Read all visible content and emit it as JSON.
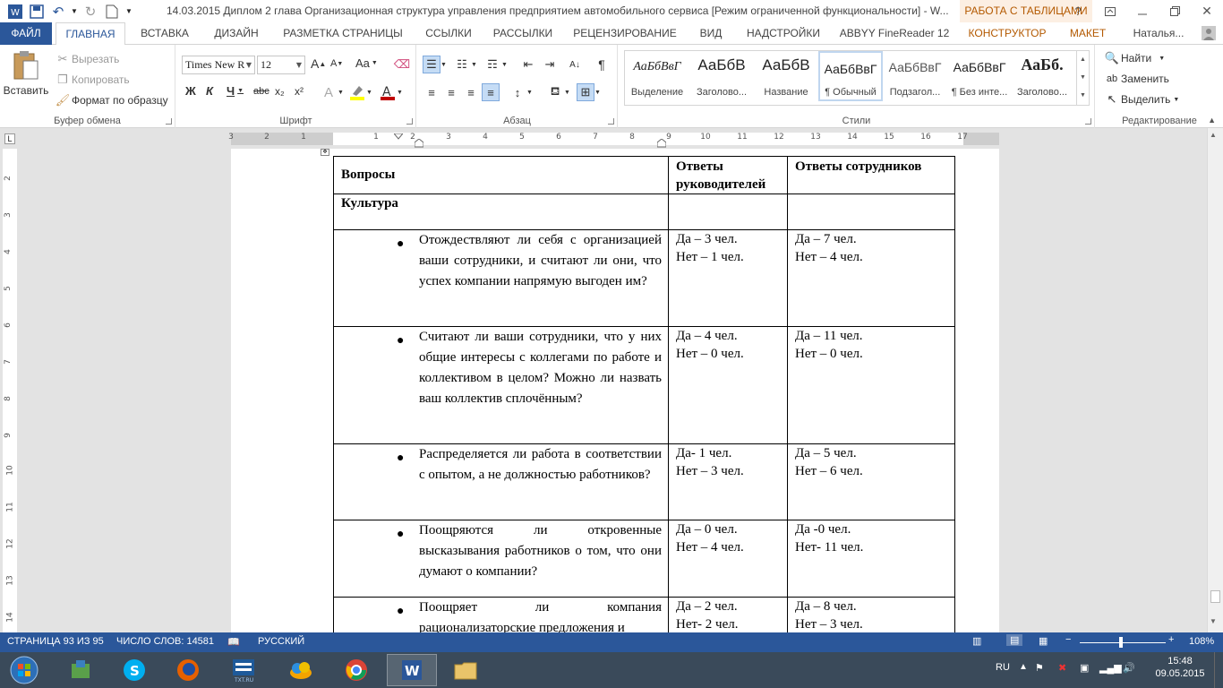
{
  "window": {
    "title": "14.03.2015 Диплом 2 глава Организационная структура управления предприятием автомобильного сервиса [Режим ограниченной функциональности] - W...",
    "context_group": "РАБОТА С ТАБЛИЦАМИ"
  },
  "tabs": {
    "file": "ФАЙЛ",
    "items": [
      "ГЛАВНАЯ",
      "ВСТАВКА",
      "ДИЗАЙН",
      "РАЗМЕТКА СТРАНИЦЫ",
      "ССЫЛКИ",
      "РАССЫЛКИ",
      "РЕЦЕНЗИРОВАНИЕ",
      "ВИД",
      "НАДСТРОЙКИ",
      "ABBYY FineReader 12",
      "КОНСТРУКТОР",
      "МАКЕТ"
    ],
    "user": "Наталья..."
  },
  "clipboard": {
    "paste": "Вставить",
    "cut": "Вырезать",
    "copy": "Копировать",
    "format_painter": "Формат по образцу",
    "label": "Буфер обмена"
  },
  "font": {
    "name": "Times New R",
    "size": "12",
    "label": "Шрифт",
    "bold": "Ж",
    "italic": "К",
    "underline": "Ч",
    "strike": "abc",
    "sub": "x₂",
    "sup": "x²",
    "case": "Aa",
    "grow": "A",
    "shrink": "A"
  },
  "paragraph": {
    "label": "Абзац"
  },
  "styles": {
    "label": "Стили",
    "items": [
      {
        "sample": "АаБбВвГ",
        "name": "Выделение"
      },
      {
        "sample": "АаБбВ",
        "name": "Заголово..."
      },
      {
        "sample": "АаБбВ",
        "name": "Название"
      },
      {
        "sample": "АаБбВвГ",
        "name": "¶ Обычный"
      },
      {
        "sample": "АаБбВвГ",
        "name": "Подзагол..."
      },
      {
        "sample": "АаБбВвГ",
        "name": "¶ Без инте..."
      },
      {
        "sample": "АаБб.",
        "name": "Заголово..."
      }
    ]
  },
  "editing": {
    "find": "Найти",
    "replace": "Заменить",
    "select": "Выделить",
    "label": "Редактирование"
  },
  "ruler": {
    "h_numbers": [
      "3",
      "2",
      "1",
      "1",
      "2",
      "3",
      "4",
      "5",
      "6",
      "7",
      "8",
      "9",
      "10",
      "11",
      "12",
      "13",
      "14",
      "15",
      "16",
      "17"
    ],
    "v_numbers": [
      "2",
      "3",
      "4",
      "5",
      "6",
      "7",
      "8",
      "9",
      "10",
      "11",
      "12",
      "13",
      "14"
    ]
  },
  "table": {
    "headers": [
      "Вопросы",
      "Ответы руководителей",
      "Ответы сотрудников"
    ],
    "section": "Культура",
    "rows": [
      {
        "q": "Отождествляют ли себя с организацией ваши сотрудники, и считают ли они, что успех компании напрямую выгоден им?",
        "m1": "Да – 3 чел.",
        "m2": "Нет – 1 чел.",
        "e1": "Да – 7 чел.",
        "e2": "Нет – 4 чел."
      },
      {
        "q": "Считают ли ваши сотрудники, что у них общие интересы с коллегами по работе и коллективом в целом? Можно ли назвать ваш коллектив сплочённым?",
        "m1": "Да – 4 чел.",
        "m2": "Нет – 0 чел.",
        "e1": "Да – 11 чел.",
        "e2": "Нет – 0 чел."
      },
      {
        "q": "Распределяется ли работа в соответствии с опытом, а не должностью работников?",
        "m1": "Да- 1 чел.",
        "m2": "Нет – 3 чел.",
        "e1": "Да – 5 чел.",
        "e2": "Нет – 6 чел."
      },
      {
        "q": "Поощряются ли откровенные высказывания работников о том, что они думают о компании?",
        "m1": "Да – 0 чел.",
        "m2": "Нет – 4 чел.",
        "e1": "Да -0 чел.",
        "e2": "Нет- 11 чел."
      },
      {
        "q": "Поощряет ли компания рационализаторские предложения и",
        "m1": "Да – 2 чел.",
        "m2": "Нет- 2 чел.",
        "e1": "Да – 8 чел.",
        "e2": "Нет – 3 чел."
      }
    ]
  },
  "status": {
    "page": "СТРАНИЦА 93 ИЗ 95",
    "words": "ЧИСЛО СЛОВ: 14581",
    "lang": "РУССКИЙ",
    "zoom": "108%"
  },
  "taskbar": {
    "lang": "RU",
    "time": "15:48",
    "date": "09.05.2015"
  }
}
